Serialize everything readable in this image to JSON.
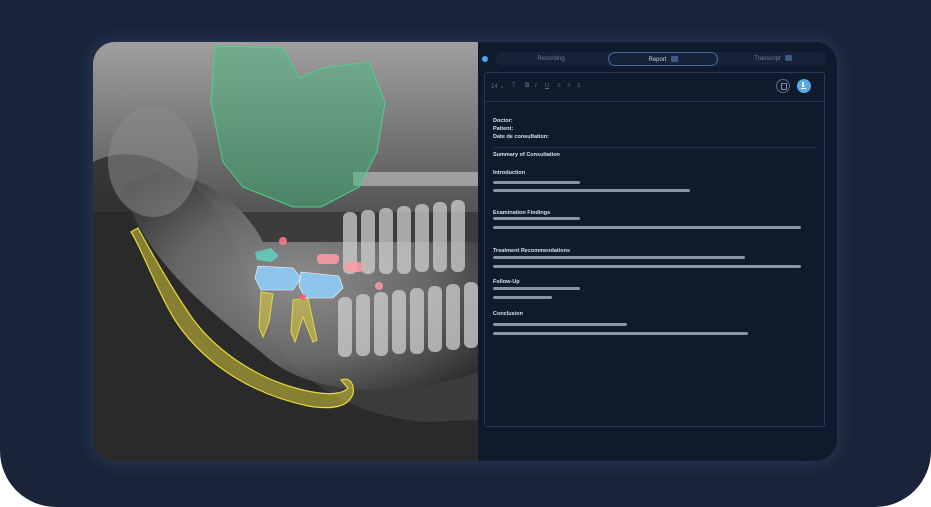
{
  "tabs": [
    {
      "label": "Recording"
    },
    {
      "label": "Report"
    },
    {
      "label": "Transcript"
    }
  ],
  "toolbar": {
    "font_size": "14 ⌄",
    "buttons": [
      "T",
      "B",
      "I",
      "U",
      "≡",
      "≡",
      "≡"
    ]
  },
  "report": {
    "doctor_label": "Doctor:",
    "patient_label": "Patient:",
    "date_label": "Date de consultation:",
    "summary_title": "Summary of Consultation",
    "sections": [
      {
        "title": "Introduction"
      },
      {
        "title": "Examination Findings"
      },
      {
        "title": "Treatment Recommendations"
      },
      {
        "title": "Follow-Up"
      },
      {
        "title": "Conclusion"
      }
    ]
  },
  "icons": {
    "copy": "copy-icon",
    "download": "download-icon",
    "logo": "logo-dot-icon"
  },
  "colors": {
    "background": "#19243a",
    "panel": "#0f1a2c",
    "accent": "#5aa7e6",
    "annotation_sinus": "#3fbf7a",
    "annotation_nerve": "#e3d43a",
    "annotation_crown": "#8fd0ff",
    "annotation_lesion": "#ff7d8a"
  }
}
